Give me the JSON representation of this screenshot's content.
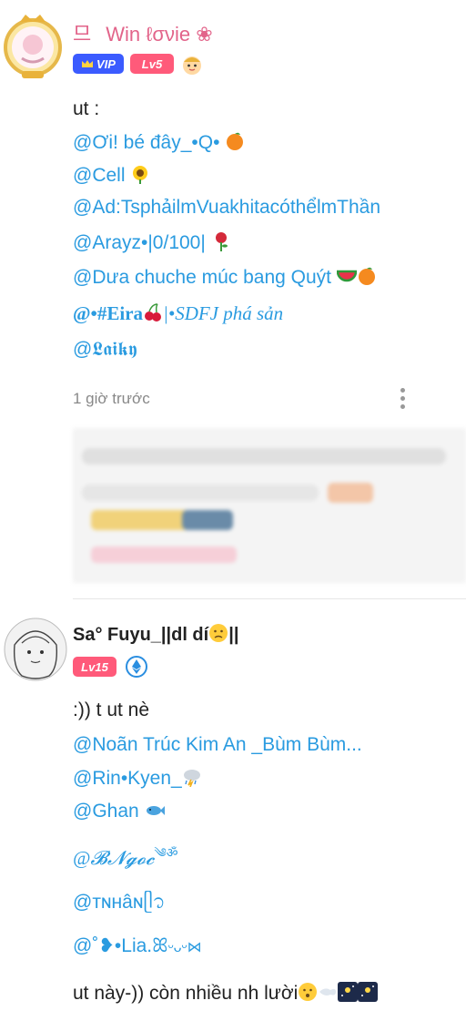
{
  "post1": {
    "author": {
      "prefix": "므",
      "name": "Win ℓσνie",
      "suffix": "❀"
    },
    "badges": {
      "vip": "VIP",
      "level": "Lv5"
    },
    "lines": [
      {
        "text": "ut :",
        "type": "plain"
      },
      {
        "text": "@Ơi! bé đây_•Q•",
        "type": "mention",
        "emoji": "orange"
      },
      {
        "text": "@Cell",
        "type": "mention",
        "emoji": "sunflower"
      },
      {
        "text": "@Ad:TsphảilmVuakhitacóthểlmThần",
        "type": "mention"
      },
      {
        "text": "@Arayz•|0/100|",
        "type": "mention",
        "emoji": "rose"
      },
      {
        "text": "@Dưa chuche múc bang Quýt",
        "type": "mention",
        "emoji": "watermelon-orange"
      },
      {
        "text": "@•#Eira",
        "type": "mention",
        "emoji": "cherries",
        "after": "|•SDFJ phá sản"
      },
      {
        "text": "@𝕷𝖆𝖎𝖐𝖞",
        "type": "mention"
      }
    ],
    "timestamp": "1 giờ trước"
  },
  "post2": {
    "author": {
      "name": "Sa° Fuyu_||dl dí",
      "suffix": "||"
    },
    "badges": {
      "level": "Lv15"
    },
    "lines": [
      {
        "text": ":)) t ut nè",
        "type": "plain"
      },
      {
        "text": "@Noãn Trúc Kim An _Bùm Bùm...",
        "type": "mention"
      },
      {
        "text": "@Rin•Kyen_",
        "type": "mention",
        "emoji": "cloud-rain"
      },
      {
        "text": "@Ghan",
        "type": "mention",
        "emoji": "fish"
      },
      {
        "text": "@𝓑𝓝𝓰𝓸𝓬",
        "type": "mention",
        "after": "༄ॐ"
      },
      {
        "text": "@ᴛɴʜâɴ",
        "type": "mention",
        "after": "ᥫ᭡"
      },
      {
        "text": "@˚❥•Lia.ꕤ",
        "type": "mention",
        "after": "ᵕᴗᵕ⋈"
      },
      {
        "text": "ut này-)) còn nhiều nh lười",
        "type": "plain",
        "emoji": "surprised-face"
      }
    ]
  },
  "colors": {
    "mention": "#2a9be0",
    "name1": "#e2648a",
    "vip": "#3b5bff",
    "level": "#ff5a7a"
  }
}
